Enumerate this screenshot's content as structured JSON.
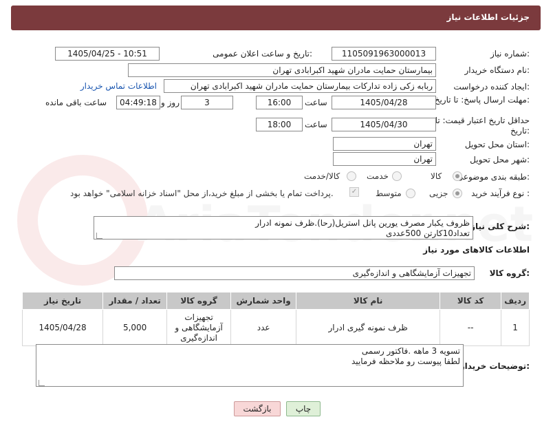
{
  "header": {
    "title": "جزئیات اطلاعات نیاز"
  },
  "form": {
    "need_number": {
      "label": "شماره نیاز:",
      "value": "1105091963000013"
    },
    "announce_datetime": {
      "label": "تاریخ و ساعت اعلان عمومی:",
      "value": "1405/04/25 - 10:51"
    },
    "buyer_org": {
      "label": "نام دستگاه خریدار:",
      "value": "بیمارستان حمایت مادران شهید اکبرابادی تهران"
    },
    "requester": {
      "label": "ایجاد کننده درخواست:",
      "value": "ربابه  زکی زاده تدارکات بیمارستان حمایت مادران شهید اکبرابادی تهران",
      "contact_link": "اطلاعات تماس خریدار"
    },
    "reply_deadline": {
      "label": "مهلت ارسال پاسخ: تا تاریخ:",
      "date": "1405/04/28",
      "time_label": "ساعت",
      "time": "16:00",
      "days": "3",
      "days_label": "روز و",
      "remaining": "04:49:18",
      "remaining_label": "ساعت باقی مانده"
    },
    "price_validity": {
      "label": "حداقل تاریخ اعتبار قیمت: تا تاریخ:",
      "date": "1405/04/30",
      "time_label": "ساعت",
      "time": "18:00"
    },
    "delivery_province": {
      "label": "استان محل تحویل:",
      "value": "تهران"
    },
    "delivery_city": {
      "label": "شهر محل تحویل:",
      "value": "تهران"
    },
    "category": {
      "label": "طبقه بندی موضوعی:",
      "options": [
        "کالا",
        "خدمت",
        "کالا/خدمت"
      ],
      "selected": "کالا"
    },
    "process_type": {
      "label": "نوع فرآیند خرید :",
      "options": [
        "جزیی",
        "متوسط"
      ],
      "selected": "جزیی",
      "payment_note": "پرداخت تمام یا بخشی از مبلغ خرید،از محل \"اسناد خزانه اسلامی\" خواهد بود."
    }
  },
  "summary": {
    "label": "شرح کلی نیاز:",
    "text": "ظروف یکبار مصرف یورین پانل استریل(رحا).ظرف نمونه ادرار\nتعداد10کارتن 500عددی"
  },
  "goods_section": {
    "title": "اطلاعات کالاهای مورد نیاز"
  },
  "goods_group": {
    "label": "گروه کالا:",
    "value": "تجهیزات آزمایشگاهی و اندازه‌گیری"
  },
  "table": {
    "headers": [
      "ردیف",
      "کد کالا",
      "نام کالا",
      "واحد شمارش",
      "گروه کالا",
      "تعداد / مقدار",
      "تاریخ نیاز"
    ],
    "rows": [
      [
        "1",
        "--",
        "ظرف نمونه گیری ادرار",
        "عدد",
        "تجهیزات آزمایشگاهی و اندازه‌گیری",
        "5,000",
        "1405/04/28"
      ]
    ]
  },
  "buyer_notes": {
    "label": "توضیحات خریدار:",
    "text": "تسویه 3 ماهه .فاکتور رسمی\nلطفا پیوست رو ملاحظه فرمایید"
  },
  "buttons": {
    "print": "چاپ",
    "back": "بازگشت"
  },
  "colors": {
    "header": "#7b3a3d",
    "table_header": "#c8c8c8",
    "print_btn": "#dff0d8",
    "back_btn": "#f8d7d7"
  }
}
